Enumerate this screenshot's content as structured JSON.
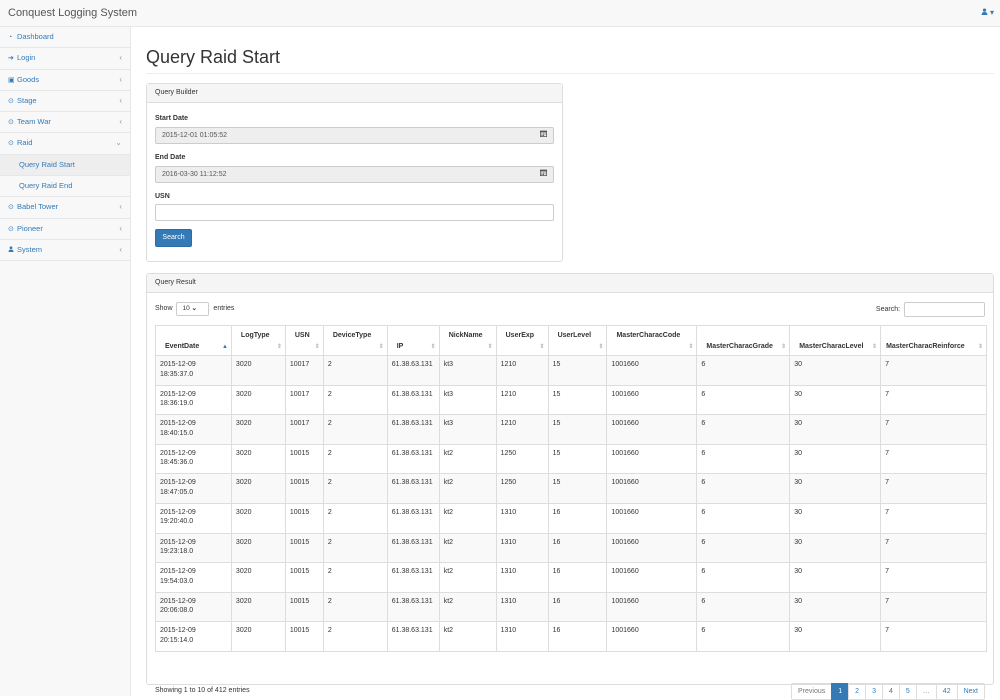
{
  "app": {
    "title": "Conquest Logging System"
  },
  "sidebar": {
    "items": [
      {
        "label": "Dashboard",
        "icon": "dashboard-icon"
      },
      {
        "label": "Login",
        "icon": "sign-in-icon"
      },
      {
        "label": "Goods",
        "icon": "money-icon"
      },
      {
        "label": "Stage",
        "icon": "play-circle-icon"
      },
      {
        "label": "Team War",
        "icon": "play-circle-icon"
      },
      {
        "label": "Raid",
        "icon": "play-circle-icon"
      },
      {
        "label": "Query Raid Start"
      },
      {
        "label": "Query Raid End"
      },
      {
        "label": "Babel Tower",
        "icon": "play-circle-icon"
      },
      {
        "label": "Pioneer",
        "icon": "play-circle-icon"
      },
      {
        "label": "System",
        "icon": "user-icon"
      }
    ]
  },
  "page": {
    "title": "Query Raid Start"
  },
  "query_builder": {
    "heading": "Query Builder",
    "start_label": "Start Date",
    "start_value": "2015-12-01 01:05:52",
    "end_label": "End Date",
    "end_value": "2016-03-30 11:12:52",
    "usn_label": "USN",
    "usn_value": "",
    "search_label": "Search"
  },
  "result": {
    "heading": "Query Result",
    "show_label": "Show",
    "page_size": "10",
    "entries_label": "entries",
    "search_label": "Search:",
    "columns": [
      "EventDate",
      "LogType",
      "USN",
      "DeviceType",
      "IP",
      "NickName",
      "UserExp",
      "UserLevel",
      "MasterCharacCode",
      "MasterCharacGrade",
      "MasterCharacLevel",
      "MasterCharacReinforce"
    ],
    "rows": [
      [
        "2015-12-09 18:35:37.0",
        "3020",
        "10017",
        "2",
        "61.38.63.131",
        "kt3",
        "1210",
        "15",
        "1001660",
        "6",
        "30",
        "7"
      ],
      [
        "2015-12-09 18:36:19.0",
        "3020",
        "10017",
        "2",
        "61.38.63.131",
        "kt3",
        "1210",
        "15",
        "1001660",
        "6",
        "30",
        "7"
      ],
      [
        "2015-12-09 18:40:15.0",
        "3020",
        "10017",
        "2",
        "61.38.63.131",
        "kt3",
        "1210",
        "15",
        "1001660",
        "6",
        "30",
        "7"
      ],
      [
        "2015-12-09 18:45:36.0",
        "3020",
        "10015",
        "2",
        "61.38.63.131",
        "kt2",
        "1250",
        "15",
        "1001660",
        "6",
        "30",
        "7"
      ],
      [
        "2015-12-09 18:47:05.0",
        "3020",
        "10015",
        "2",
        "61.38.63.131",
        "kt2",
        "1250",
        "15",
        "1001660",
        "6",
        "30",
        "7"
      ],
      [
        "2015-12-09 19:20:40.0",
        "3020",
        "10015",
        "2",
        "61.38.63.131",
        "kt2",
        "1310",
        "16",
        "1001660",
        "6",
        "30",
        "7"
      ],
      [
        "2015-12-09 19:23:18.0",
        "3020",
        "10015",
        "2",
        "61.38.63.131",
        "kt2",
        "1310",
        "16",
        "1001660",
        "6",
        "30",
        "7"
      ],
      [
        "2015-12-09 19:54:03.0",
        "3020",
        "10015",
        "2",
        "61.38.63.131",
        "kt2",
        "1310",
        "16",
        "1001660",
        "6",
        "30",
        "7"
      ],
      [
        "2015-12-09 20:06:08.0",
        "3020",
        "10015",
        "2",
        "61.38.63.131",
        "kt2",
        "1310",
        "16",
        "1001660",
        "6",
        "30",
        "7"
      ],
      [
        "2015-12-09 20:15:14.0",
        "3020",
        "10015",
        "2",
        "61.38.63.131",
        "kt2",
        "1310",
        "16",
        "1001660",
        "6",
        "30",
        "7"
      ]
    ],
    "info": "Showing 1 to 10 of 412 entries",
    "pagination": [
      "Previous",
      "1",
      "2",
      "3",
      "4",
      "5",
      "…",
      "42",
      "Next"
    ]
  }
}
